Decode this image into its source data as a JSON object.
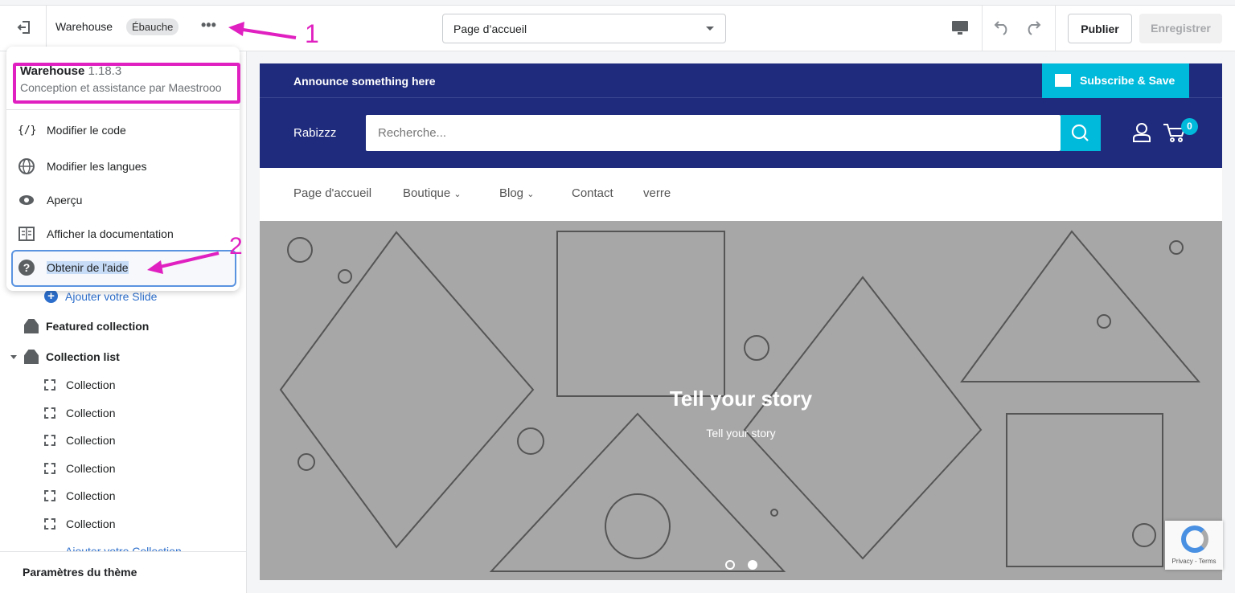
{
  "topbar": {
    "exit_icon": "exit-icon",
    "theme_name": "Warehouse",
    "status_badge": "Ébauche",
    "more_icon": "ellipsis-icon",
    "page_select": "Page d’accueil",
    "device_icon": "desktop-icon",
    "publish": "Publier",
    "save": "Enregistrer"
  },
  "menu": {
    "theme_name": "Warehouse",
    "version": "1.18.3",
    "credit": "Conception et assistance par Maestrooo",
    "items": [
      {
        "label": "Modifier le code",
        "icon": "code-icon"
      },
      {
        "label": "Modifier les langues",
        "icon": "globe-icon"
      },
      {
        "label": "Aperçu",
        "icon": "eye-icon"
      },
      {
        "label": "Afficher la documentation",
        "icon": "book-icon"
      },
      {
        "label": "Obtenir de l'aide",
        "icon": "help-icon"
      }
    ]
  },
  "sidebar": {
    "add_slide": "Ajouter votre Slide",
    "featured": "Featured collection",
    "collection_list": "Collection list",
    "collections": [
      "Collection",
      "Collection",
      "Collection",
      "Collection",
      "Collection",
      "Collection"
    ],
    "add_collection": "Ajouter votre Collection",
    "theme_settings": "Paramètres du thème"
  },
  "annotations": {
    "step1": "1",
    "step2": "2",
    "color": "#e020c0"
  },
  "store": {
    "announcement": "Announce something here",
    "subscribe": "Subscribe & Save",
    "logo": "Rabizzz",
    "search_placeholder": "Recherche...",
    "cart_count": "0",
    "nav": [
      "Page d'accueil",
      "Boutique",
      "Blog",
      "Contact",
      "verre"
    ],
    "hero_title": "Tell your story",
    "hero_subtitle": "Tell your story",
    "recaptcha": "Privacy - Terms",
    "colors": {
      "navy": "#1f2b7c",
      "accent": "#00badb"
    }
  }
}
